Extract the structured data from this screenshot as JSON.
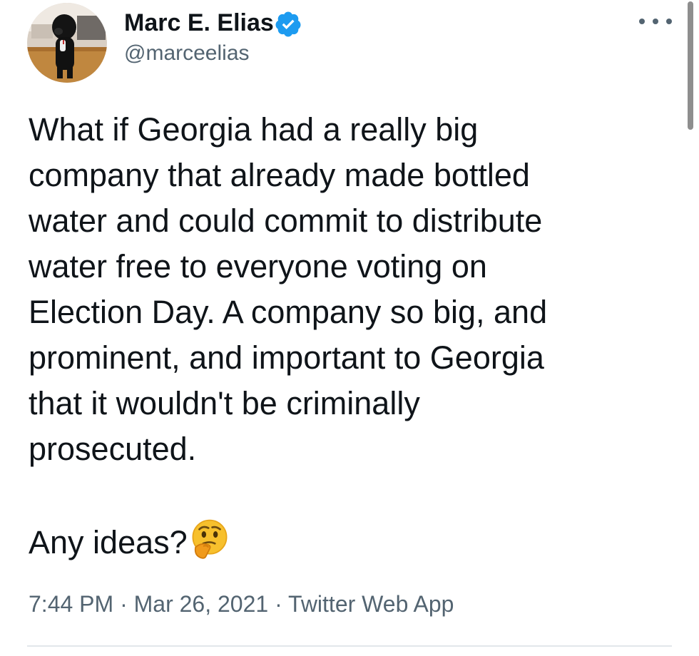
{
  "tweet": {
    "author": {
      "display_name": "Marc E. Elias",
      "handle": "@marceelias",
      "verified": true,
      "avatar_icon": "avatar-dog-photo",
      "verified_icon": "verified-badge-icon"
    },
    "more_icon": "more-horizontal-icon",
    "body": {
      "paragraph_1": "What if Georgia had a really big\ncompany that already made bottled\nwater and could commit to distribute\nwater free to everyone voting on\nElection Day. A company so big, and\nprominent, and important to Georgia\nthat it wouldn't be criminally\nprosecuted.",
      "paragraph_2": "Any ideas?",
      "emoji": "thinking-face-icon"
    },
    "meta": {
      "time": "7:44 PM",
      "separator": " · ",
      "date": "Mar 26, 2021",
      "source": "Twitter Web App"
    }
  },
  "colors": {
    "text_primary": "#0f1419",
    "text_secondary": "#536471",
    "verified_blue": "#1d9bf0",
    "divider": "#e2e6ea"
  }
}
